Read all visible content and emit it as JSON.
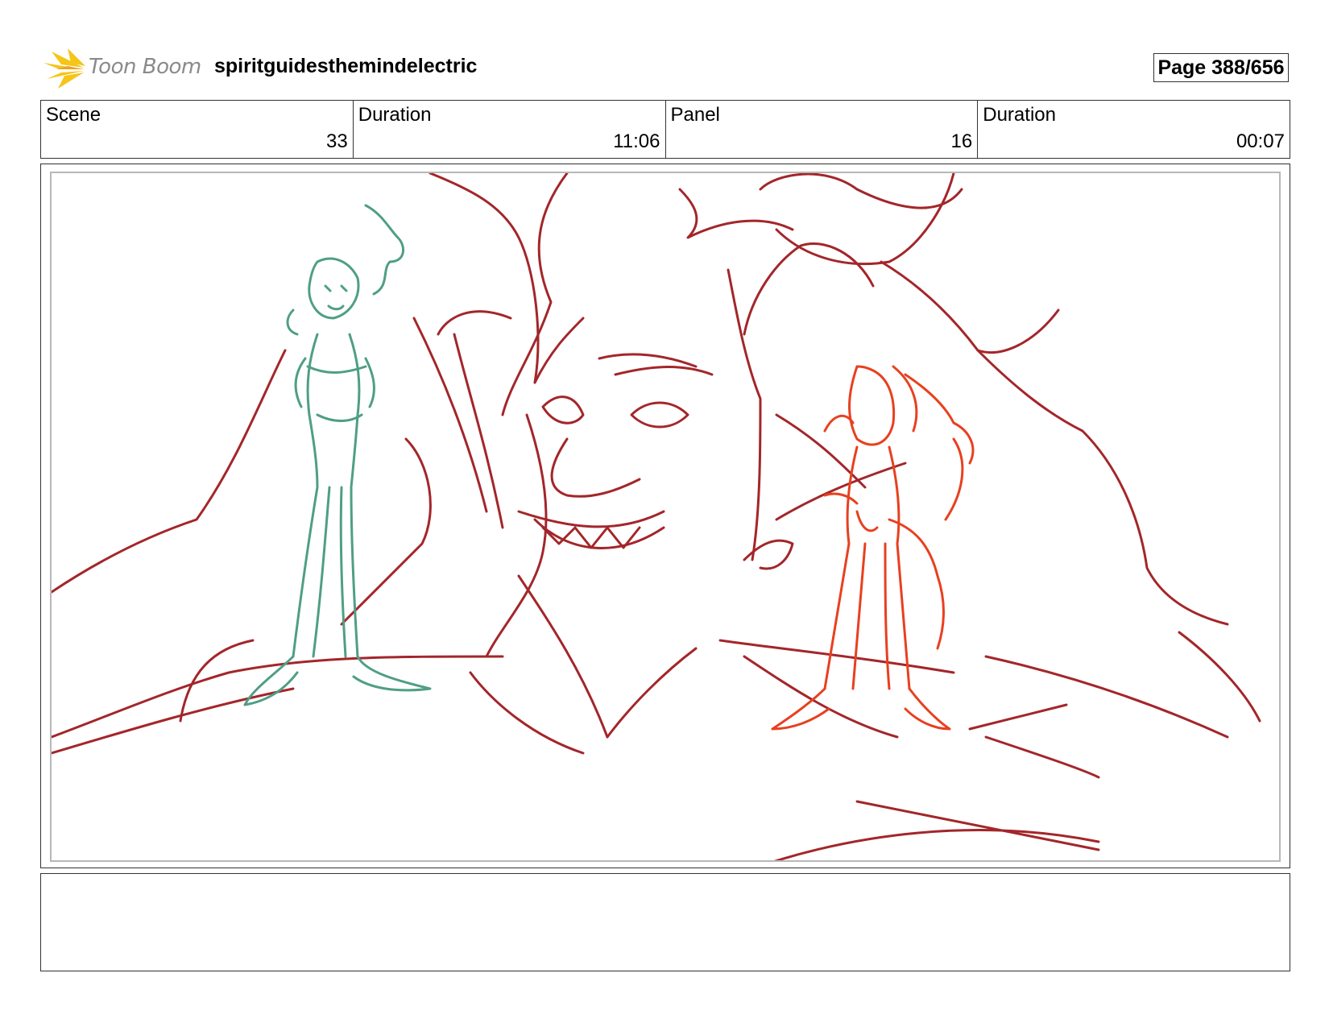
{
  "header": {
    "logo_text": "Toon Boom",
    "project_title": "spiritguidesthemindelectric",
    "page_label": "Page 388/656"
  },
  "info": {
    "scene_label": "Scene",
    "scene_value": "33",
    "scene_duration_label": "Duration",
    "scene_duration_value": "11:06",
    "panel_label": "Panel",
    "panel_value": "16",
    "panel_duration_label": "Duration",
    "panel_duration_value": "00:07"
  },
  "colors": {
    "demon_line": "#a3262a",
    "left_character_line": "#4f9e86",
    "right_character_line": "#e8401f",
    "logo_yellow": "#f5c518",
    "frame_border": "#333333"
  },
  "notes": {
    "text": ""
  }
}
